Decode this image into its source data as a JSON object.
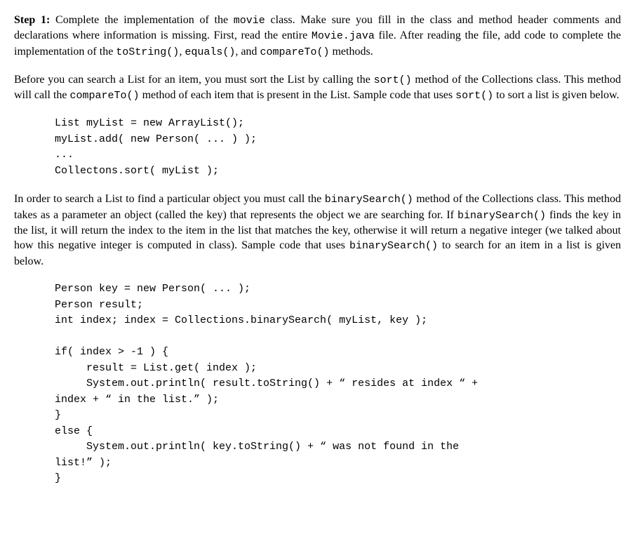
{
  "p1": {
    "step_label": "Step 1:",
    "t1": " Complete the implementation of the ",
    "c1": "movie",
    "t2": "  class. Make sure you fill in the class and method header comments and declarations where information is missing. First, read the entire ",
    "c2": "Movie.java",
    "t3": " file. After reading the file, add code to complete the implementation of the ",
    "c3": "toString()",
    "t4": ", ",
    "c4": "equals()",
    "t5": ", and ",
    "c5": "compareTo()",
    "t6": " methods."
  },
  "p2": {
    "t1": "Before you can search a List for an item, you must sort the List by calling the ",
    "c1": "sort()",
    "t2": " method of the Collections class. This method will call the ",
    "c2": "compareTo()",
    "t3": " method of each item that is present in the List. Sample code that uses ",
    "c3": "sort()",
    "t4": " to sort a list is given below."
  },
  "code1": "List myList = new ArrayList();\nmyList.add( new Person( ... ) );\n...\nCollectons.sort( myList );",
  "p3": {
    "t1": "In order to search a List to find a particular object you must call the ",
    "c1": "binarySearch()",
    "t2": " method of the Collections class. This method takes as a parameter an object (called the key) that represents the object we are searching for. If ",
    "c2": "binarySearch()",
    "t3": " finds the key in the list, it will return the index to the item in the list that matches the key, otherwise it will return a negative integer (we talked about how this negative integer is computed in class). Sample code that uses ",
    "c3": "binarySearch()",
    "t4": " to search for an item in a list is given below."
  },
  "code2": "Person key = new Person( ... );\nPerson result;\nint index; index = Collections.binarySearch( myList, key );\n\nif( index > -1 ) {\n     result = List.get( index );\n     System.out.println( result.toString() + “ resides at index “ +\nindex + “ in the list.” );\n}\nelse {\n     System.out.println( key.toString() + “ was not found in the\nlist!” );\n}"
}
